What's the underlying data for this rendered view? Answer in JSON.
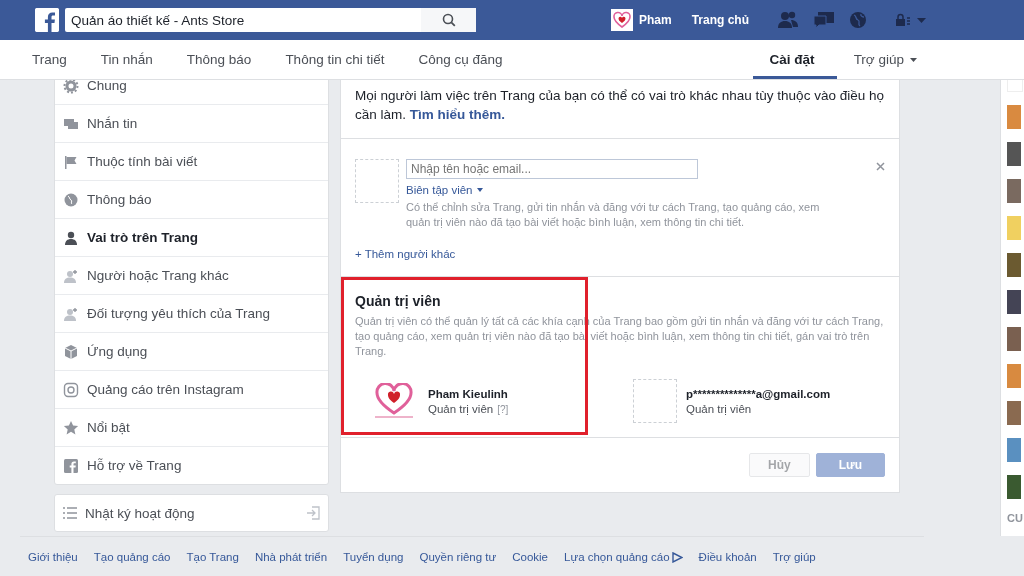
{
  "topbar": {
    "search_value": "Quản áo thiết kế - Ants Store",
    "profile_name": "Pham",
    "home_link": "Trang chủ"
  },
  "tabs": [
    {
      "label": "Trang",
      "selected": false,
      "dropdown": false
    },
    {
      "label": "Tin nhắn",
      "selected": false,
      "dropdown": false
    },
    {
      "label": "Thông báo",
      "selected": false,
      "dropdown": false
    },
    {
      "label": "Thông tin chi tiết",
      "selected": false,
      "dropdown": false
    },
    {
      "label": "Công cụ đăng",
      "selected": false,
      "dropdown": false
    },
    {
      "label": "Cài đặt",
      "selected": true,
      "dropdown": false
    },
    {
      "label": "Trợ giúp",
      "selected": false,
      "dropdown": true
    }
  ],
  "sidebar": {
    "items": [
      {
        "label": "Chung",
        "kind": "gear",
        "selected": false
      },
      {
        "label": "Nhắn tin",
        "kind": "chat",
        "selected": false
      },
      {
        "label": "Thuộc tính bài viết",
        "kind": "flag",
        "selected": false
      },
      {
        "label": "Thông báo",
        "kind": "globe",
        "selected": false
      },
      {
        "label": "Vai trò trên Trang",
        "kind": "person",
        "selected": true
      },
      {
        "label": "Người hoặc Trang khác",
        "kind": "person-plus",
        "selected": false
      },
      {
        "label": "Đối tượng yêu thích của Trang",
        "kind": "person-plus",
        "selected": false
      },
      {
        "label": "Ứng dụng",
        "kind": "cube",
        "selected": false
      },
      {
        "label": "Quảng cáo trên Instagram",
        "kind": "camera",
        "selected": false
      },
      {
        "label": "Nổi bật",
        "kind": "star",
        "selected": false
      },
      {
        "label": "Hỗ trợ về Trang",
        "kind": "f-square",
        "selected": false
      }
    ],
    "activity_log": {
      "label": "Nhật ký hoạt động"
    }
  },
  "roles": {
    "intro": {
      "text": "Mọi người làm việc trên Trang của bạn có thể có vai trò khác nhau tùy thuộc vào điều họ cần làm.",
      "link": "Tìm hiểu thêm."
    },
    "add_person": {
      "placeholder": "Nhập tên hoặc email...",
      "role": "Biên tập viên",
      "role_description": "Có thể chỉnh sửa Trang, gửi tin nhắn và đăng với tư cách Trang, tạo quảng cáo, xem quản trị viên nào đã tạo bài viết hoặc bình luận, xem thông tin chi tiết.",
      "add_more": "+ Thêm người khác"
    },
    "admins": {
      "title": "Quản trị viên",
      "highlighted": true,
      "description": "Quản trị viên có thể quản lý tất cả các khía cạnh của Trang bao gồm gửi tin nhắn và đăng với tư cách Trang, tạo quảng cáo, xem quản trị viên nào đã tạo bài viết hoặc bình luận, xem thông tin chi tiết, gán vai trò trên Trang.",
      "members": [
        {
          "name": "Pham Kieulinh",
          "role": "Quản trị viên",
          "help": "[?]",
          "kind": "logo"
        },
        {
          "name": "p**************a@gmail.com",
          "role": "Quản trị viên",
          "kind": "empty"
        }
      ]
    },
    "buttons": [
      {
        "label": "Hủy",
        "kind": "secondary",
        "disabled": true
      },
      {
        "label": "Lưu",
        "kind": "primary",
        "disabled": true
      }
    ]
  },
  "footer": {
    "links": [
      "Giới thiệu",
      "Tạo quảng cáo",
      "Tạo Trang",
      "Nhà phát triển",
      "Tuyển dụng",
      "Quyền riêng tư",
      "Cookie",
      "Lựa chọn quảng cáo",
      "Điều khoản",
      "Trợ giúp"
    ]
  },
  "rail": {
    "heading": "CU"
  }
}
